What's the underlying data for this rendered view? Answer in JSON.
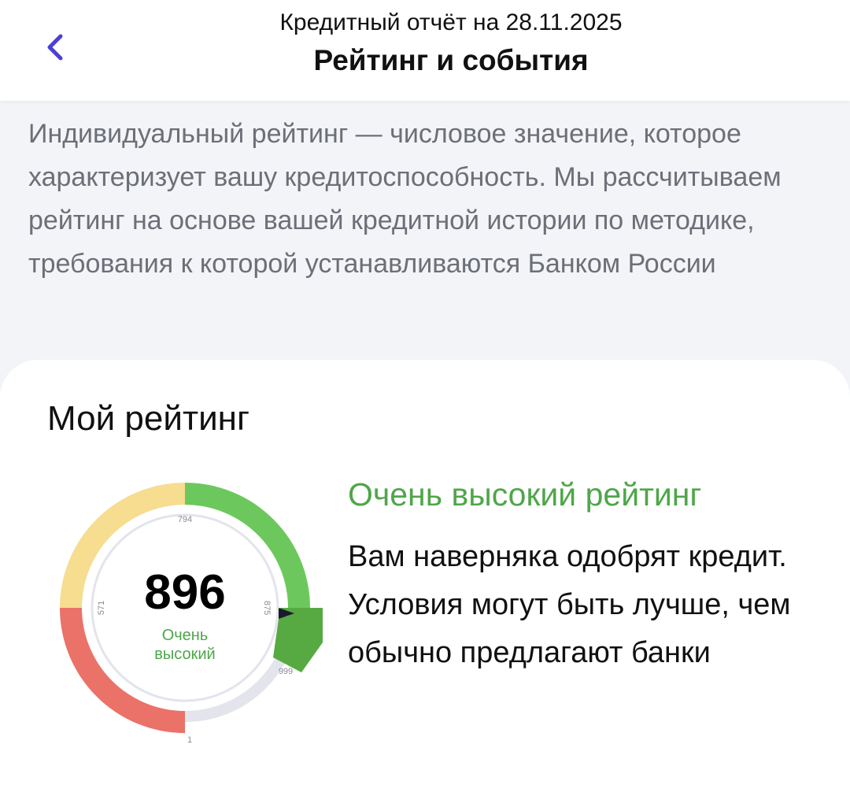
{
  "header": {
    "subtitle": "Кредитный отчёт на 28.11.2025",
    "title": "Рейтинг и события",
    "back_icon": "chevron-left-icon",
    "accent_color": "#4b3fd6"
  },
  "description": "Индивидуальный рейтинг — числовое значение, которое характеризует вашу кредитоспособность. Мы рассчитываем рейтинг на основе вашей кредитной истории по методике, требования к которой устанавливаются Банком России",
  "rating_card": {
    "title": "Мой рейтинг",
    "score": "896",
    "score_label": "Очень высокий",
    "headline": "Очень высокий рейтинг",
    "message": "Вам наверняка одобрят кредит. Условия могут быть лучше, чем обычно предлагают банки",
    "gauge": {
      "min_label": "1",
      "max_label": "999",
      "tick_labels": [
        "571",
        "794",
        "875"
      ],
      "value": 896,
      "segments": [
        {
          "range": [
            1,
            571
          ],
          "color": "#ea7268"
        },
        {
          "range": [
            571,
            794
          ],
          "color": "#f6dd90"
        },
        {
          "range": [
            794,
            875
          ],
          "color": "#6cc85c"
        },
        {
          "range": [
            875,
            999
          ],
          "color": "#57a942"
        }
      ],
      "track_color": "#e3e4ec",
      "pointer_color": "#1a1a2e"
    }
  }
}
